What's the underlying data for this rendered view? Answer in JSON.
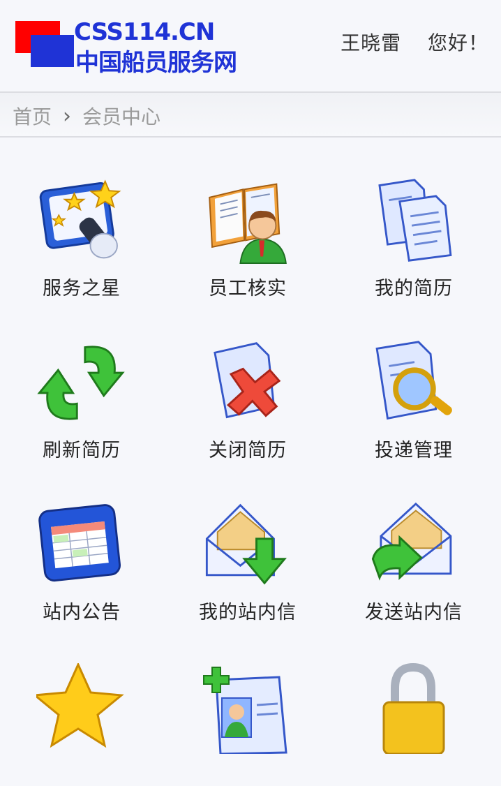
{
  "header": {
    "logo_en": "CSS114.CN",
    "logo_cn": "中国船员服务网",
    "user_name": "王晓雷",
    "greeting_suffix": "您好！"
  },
  "breadcrumb": {
    "home": "首页",
    "separator": "›",
    "current": "会员中心"
  },
  "menu": [
    {
      "label": "服务之星",
      "icon": "star-board-icon"
    },
    {
      "label": "员工核实",
      "icon": "book-person-icon"
    },
    {
      "label": "我的简历",
      "icon": "documents-icon"
    },
    {
      "label": "刷新简历",
      "icon": "refresh-arrows-icon"
    },
    {
      "label": "关闭简历",
      "icon": "close-document-icon"
    },
    {
      "label": "投递管理",
      "icon": "search-document-icon"
    },
    {
      "label": "站内公告",
      "icon": "notice-table-icon"
    },
    {
      "label": "我的站内信",
      "icon": "mail-download-icon"
    },
    {
      "label": "发送站内信",
      "icon": "mail-send-icon"
    },
    {
      "label": "",
      "icon": "star-icon"
    },
    {
      "label": "",
      "icon": "add-contact-icon"
    },
    {
      "label": "",
      "icon": "lock-icon"
    }
  ],
  "colors": {
    "brand_blue": "#1f33d6",
    "brand_red": "#ff0000",
    "background": "#f6f7fb"
  }
}
